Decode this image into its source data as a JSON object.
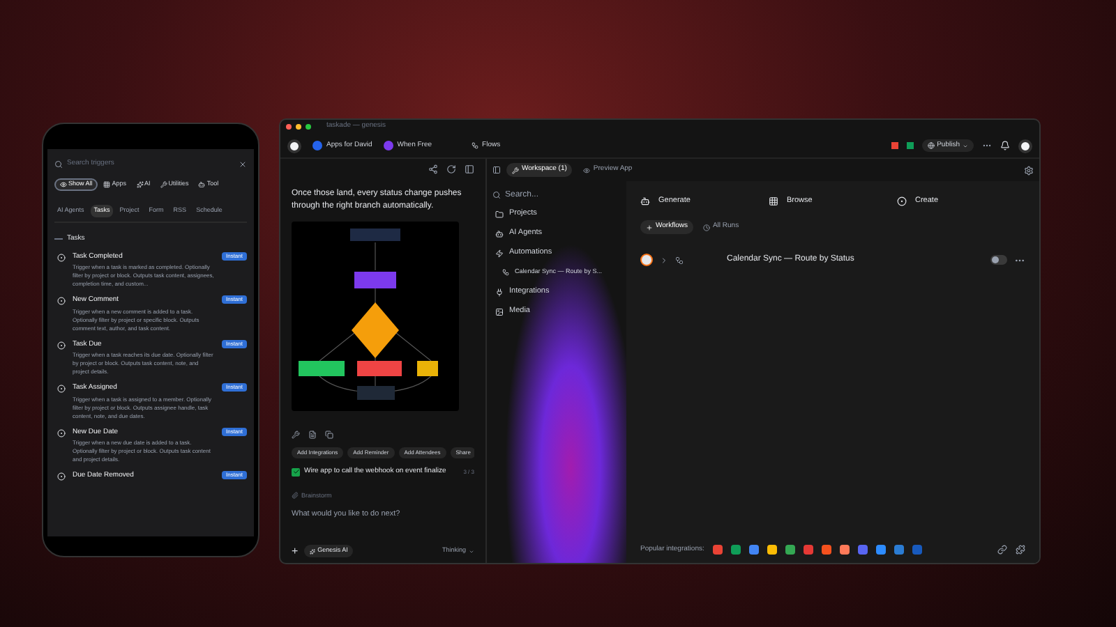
{
  "phone": {
    "search": {
      "placeholder": "Search triggers"
    },
    "chips": [
      {
        "label": "Show All",
        "selected": true
      },
      {
        "label": "Apps",
        "selected": false
      },
      {
        "label": "AI",
        "selected": false
      },
      {
        "label": "Utilities",
        "selected": false
      },
      {
        "label": "Tool",
        "selected": false
      }
    ],
    "tabs": [
      {
        "label": "AI Agents",
        "selected": false
      },
      {
        "label": "Tasks",
        "selected": true
      },
      {
        "label": "Project",
        "selected": false
      },
      {
        "label": "Form",
        "selected": false
      },
      {
        "label": "RSS",
        "selected": false
      },
      {
        "label": "Schedule",
        "selected": false
      }
    ],
    "section": "Tasks",
    "triggers": [
      {
        "title": "Task Completed",
        "description": "Trigger when a task is marked as completed. Optionally filter by project or block. Outputs task content, assignees, completion time, and custom...",
        "badge": "Instant"
      },
      {
        "title": "New Comment",
        "description": "Trigger when a new comment is added to a task. Optionally filter by project or specific block. Outputs comment text, author, and task content.",
        "badge": "Instant"
      },
      {
        "title": "Task Due",
        "description": "Trigger when a task reaches its due date. Optionally filter by project or block. Outputs task content, note, and project details.",
        "badge": "Instant"
      },
      {
        "title": "Task Assigned",
        "description": "Trigger when a task is assigned to a member. Optionally filter by project or block. Outputs assignee handle, task content, note, and due dates.",
        "badge": "Instant"
      },
      {
        "title": "New Due Date",
        "description": "Trigger when a new due date is added to a task. Optionally filter by project or block. Outputs task content and project details.",
        "badge": "Instant"
      },
      {
        "title": "Due Date Removed",
        "badge": "Instant"
      }
    ]
  },
  "window": {
    "title": "taskade — genesis",
    "breadcrumbs": [
      "Apps for David",
      "When Free",
      "Flows"
    ],
    "publish": "Publish",
    "chat": {
      "message": "Once those land, every status change pushes through the right branch automatically.",
      "suggestions": [
        "Add Integrations",
        "Add Reminder",
        "Add Attendees",
        "Share"
      ],
      "task": {
        "text": "Wire app to call the webhook on event finalize",
        "done": true,
        "count": "3 / 3"
      },
      "mention": "Brainstorm",
      "input": {
        "placeholder": "What would you like to do next?"
      },
      "plus": "+",
      "agent": "Genesis AI",
      "mode": "Thinking"
    },
    "view_tabs": [
      {
        "label": "Workspace (1)",
        "selected": true
      },
      {
        "label": "Preview App",
        "selected": false
      }
    ],
    "sidebar": {
      "search": {
        "placeholder": "Search..."
      },
      "items": [
        {
          "label": "Projects",
          "selected": false
        },
        {
          "label": "AI Agents",
          "selected": false
        },
        {
          "label": "Automations",
          "selected": false,
          "children": [
            {
              "label": "Calendar Sync — Route by S...",
              "selected": false
            }
          ]
        },
        {
          "label": "Integrations",
          "selected": false
        },
        {
          "label": "Media",
          "selected": false
        }
      ]
    },
    "actions": [
      "Generate",
      "Browse",
      "Create"
    ],
    "tabs": [
      {
        "label": "Workflows",
        "selected": true
      },
      {
        "label": "All Runs",
        "selected": false
      }
    ],
    "workflows": [
      {
        "name": "Calendar Sync — Route by Status",
        "on": false
      }
    ],
    "integrations_label": "Popular integrations:",
    "integrations": [
      {
        "color": "#ea4335"
      },
      {
        "color": "#0f9d58"
      },
      {
        "color": "#4285f4"
      },
      {
        "color": "#fbbc05"
      },
      {
        "color": "#34a853"
      },
      {
        "color": "#e53935"
      },
      {
        "color": "#f4511e"
      },
      {
        "color": "#ff7a59"
      },
      {
        "color": "#5865f2"
      },
      {
        "color": "#2d8cff"
      },
      {
        "color": "#2b7cd3"
      },
      {
        "color": "#185abd"
      }
    ]
  }
}
